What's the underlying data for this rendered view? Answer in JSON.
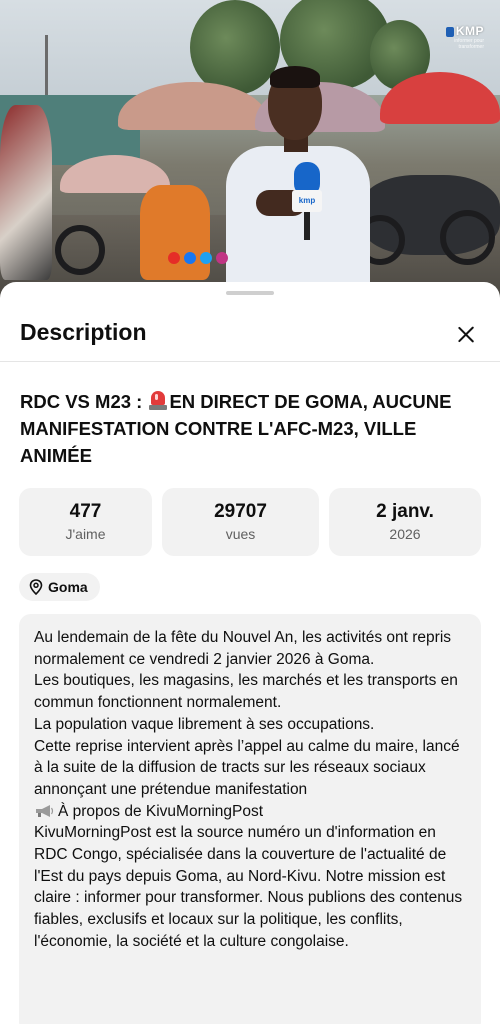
{
  "video": {
    "watermark_logo": "KMP",
    "watermark_sub": "informer pour transformer",
    "mic_label": "kmp",
    "social_icons": [
      "youtube-icon",
      "facebook-icon",
      "twitter-icon",
      "instagram-icon"
    ]
  },
  "sheet": {
    "title": "Description",
    "close_icon": "close-icon"
  },
  "video_title": {
    "part1": "RDC VS M23 : ",
    "emoji": "police-light-icon",
    "part2": "EN DIRECT DE GOMA, AUCUNE MANIFESTATION CONTRE L'AFC-M23, VILLE ANIMÉE"
  },
  "stats": [
    {
      "value": "477",
      "label": "J'aime"
    },
    {
      "value": "29707",
      "label": "vues"
    },
    {
      "value": "2 janv.",
      "label": "2026"
    }
  ],
  "location": {
    "icon": "location-pin-icon",
    "label": "Goma"
  },
  "description": {
    "para1": "Au lendemain de la fête du Nouvel An, les activités ont repris normalement ce vendredi 2 janvier 2026 à Goma.\nLes boutiques, les magasins, les marchés et les transports en commun fonctionnent normalement.\nLa population vaque librement à ses occupations.\nCette reprise intervient après l’appel au calme du maire, lancé à la suite de la diffusion de tracts sur les réseaux sociaux annonçant une prétendue manifestation",
    "about_icon": "megaphone-icon",
    "about_heading": "À propos de KivuMorningPost",
    "para2": "KivuMorningPost est la source numéro un d'information en RDC Congo, spécialisée dans la couverture de l'actualité de l'Est du pays depuis Goma, au Nord-Kivu. Notre mission est claire : informer pour transformer. Nous publions des contenus fiables, exclusifs et locaux sur la politique, les conflits, l'économie, la société et la culture congolaise."
  }
}
